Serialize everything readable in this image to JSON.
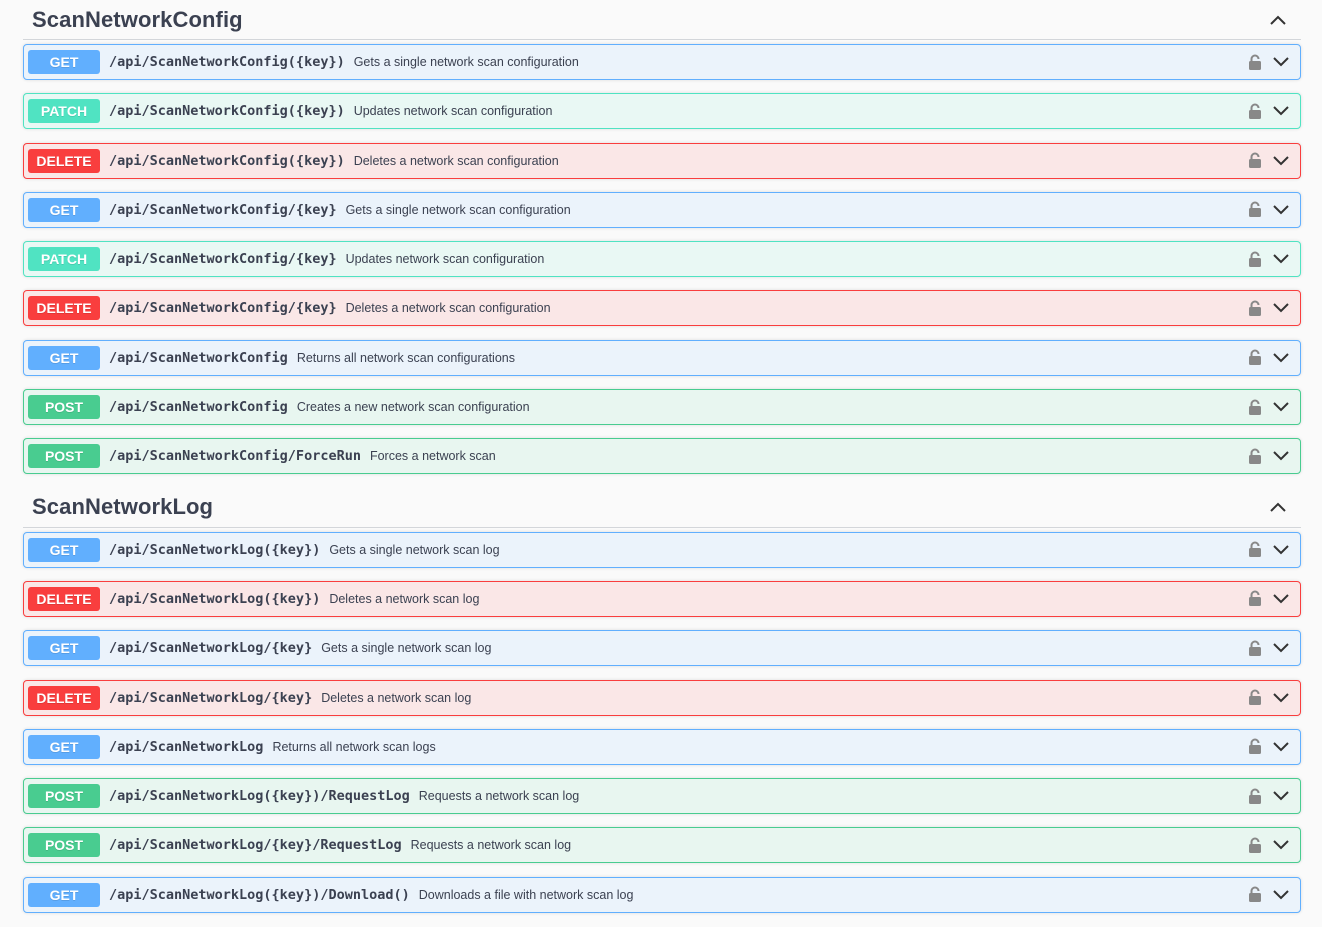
{
  "sections": [
    {
      "title": "ScanNetworkConfig",
      "operations": [
        {
          "method": "GET",
          "path": "/api/ScanNetworkConfig({key})",
          "summary": "Gets a single network scan configuration"
        },
        {
          "method": "PATCH",
          "path": "/api/ScanNetworkConfig({key})",
          "summary": "Updates network scan configuration"
        },
        {
          "method": "DELETE",
          "path": "/api/ScanNetworkConfig({key})",
          "summary": "Deletes a network scan configuration"
        },
        {
          "method": "GET",
          "path": "/api/ScanNetworkConfig/{key}",
          "summary": "Gets a single network scan configuration"
        },
        {
          "method": "PATCH",
          "path": "/api/ScanNetworkConfig/{key}",
          "summary": "Updates network scan configuration"
        },
        {
          "method": "DELETE",
          "path": "/api/ScanNetworkConfig/{key}",
          "summary": "Deletes a network scan configuration"
        },
        {
          "method": "GET",
          "path": "/api/ScanNetworkConfig",
          "summary": "Returns all network scan configurations"
        },
        {
          "method": "POST",
          "path": "/api/ScanNetworkConfig",
          "summary": "Creates a new network scan configuration"
        },
        {
          "method": "POST",
          "path": "/api/ScanNetworkConfig/ForceRun",
          "summary": "Forces a network scan"
        }
      ]
    },
    {
      "title": "ScanNetworkLog",
      "operations": [
        {
          "method": "GET",
          "path": "/api/ScanNetworkLog({key})",
          "summary": "Gets a single network scan log"
        },
        {
          "method": "DELETE",
          "path": "/api/ScanNetworkLog({key})",
          "summary": "Deletes a network scan log"
        },
        {
          "method": "GET",
          "path": "/api/ScanNetworkLog/{key}",
          "summary": "Gets a single network scan log"
        },
        {
          "method": "DELETE",
          "path": "/api/ScanNetworkLog/{key}",
          "summary": "Deletes a network scan log"
        },
        {
          "method": "GET",
          "path": "/api/ScanNetworkLog",
          "summary": "Returns all network scan logs"
        },
        {
          "method": "POST",
          "path": "/api/ScanNetworkLog({key})/RequestLog",
          "summary": "Requests a network scan log"
        },
        {
          "method": "POST",
          "path": "/api/ScanNetworkLog/{key}/RequestLog",
          "summary": "Requests a network scan log"
        },
        {
          "method": "GET",
          "path": "/api/ScanNetworkLog({key})/Download()",
          "summary": "Downloads a file with network scan log"
        }
      ]
    }
  ],
  "icons": {
    "lock": "lock-icon",
    "expand": "chevron-down-icon",
    "collapse": "chevron-up-icon"
  },
  "colors": {
    "get": "#61affe",
    "patch": "#50e3c2",
    "delete": "#f93e3e",
    "post": "#49cc90"
  }
}
